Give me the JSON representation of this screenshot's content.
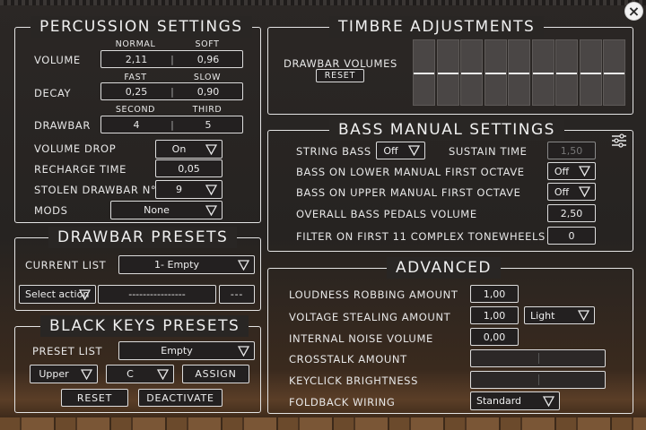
{
  "close_icon": "×",
  "percussion": {
    "title": "PERCUSSION SETTINGS",
    "volume": {
      "label": "VOLUME",
      "sub_left": "NORMAL",
      "sub_right": "SOFT",
      "left": "2,11",
      "right": "0,96"
    },
    "decay": {
      "label": "DECAY",
      "sub_left": "FAST",
      "sub_right": "SLOW",
      "left": "0,25",
      "right": "0,90"
    },
    "drawbar": {
      "label": "DRAWBAR",
      "sub_left": "SECOND",
      "sub_right": "THIRD",
      "left": "4",
      "right": "5"
    },
    "separator": "|",
    "volume_drop": {
      "label": "VOLUME DROP",
      "value": "On"
    },
    "recharge_time": {
      "label": "RECHARGE TIME",
      "value": "0,05"
    },
    "stolen_drawbar": {
      "label": "STOLEN DRAWBAR N°",
      "value": "9"
    },
    "mods": {
      "label": "MODS",
      "value": "None"
    }
  },
  "drawbar_presets": {
    "title": "DRAWBAR PRESETS",
    "current_list": {
      "label": "CURRENT LIST",
      "value": "1- Empty"
    },
    "select_action": "Select action",
    "preset_name": "----------------",
    "more_button": "---"
  },
  "black_keys": {
    "title": "BLACK KEYS PRESETS",
    "preset_list": {
      "label": "PRESET LIST",
      "value": "Empty"
    },
    "manual": "Upper",
    "key": "C",
    "assign": "ASSIGN",
    "reset": "RESET",
    "deactivate": "DEACTIVATE"
  },
  "timbre": {
    "title": "TIMBRE ADJUSTMENTS",
    "drawbar_volumes": "DRAWBAR VOLUMES",
    "reset": "RESET",
    "drawbar_levels": [
      0.5,
      0.5,
      0.5,
      0.5,
      0.5,
      0.5,
      0.5,
      0.5,
      0.5
    ]
  },
  "bass": {
    "title": "BASS MANUAL SETTINGS",
    "string_bass": {
      "label": "STRING BASS",
      "value": "Off"
    },
    "sustain_time": {
      "label": "SUSTAIN TIME",
      "value": "1,50"
    },
    "lower_first_octave": {
      "label": "BASS ON LOWER MANUAL FIRST OCTAVE",
      "value": "Off"
    },
    "upper_first_octave": {
      "label": "BASS ON UPPER MANUAL FIRST OCTAVE",
      "value": "Off"
    },
    "pedals_volume": {
      "label": "OVERALL BASS PEDALS VOLUME",
      "value": "2,50"
    },
    "filter": {
      "label": "FILTER ON FIRST 11 COMPLEX TONEWHEELS",
      "value": "0"
    }
  },
  "advanced": {
    "title": "ADVANCED",
    "loudness_robbing": {
      "label": "LOUDNESS ROBBING AMOUNT",
      "value": "1,00"
    },
    "voltage_stealing": {
      "label": "VOLTAGE STEALING AMOUNT",
      "value": "1,00",
      "mode": "Light"
    },
    "internal_noise": {
      "label": "INTERNAL NOISE VOLUME",
      "value": "0,00"
    },
    "crosstalk": {
      "label": "CROSSTALK AMOUNT"
    },
    "keyclick": {
      "label": "KEYCLICK BRIGHTNESS"
    },
    "foldback": {
      "label": "FOLDBACK WIRING",
      "value": "Standard"
    }
  }
}
